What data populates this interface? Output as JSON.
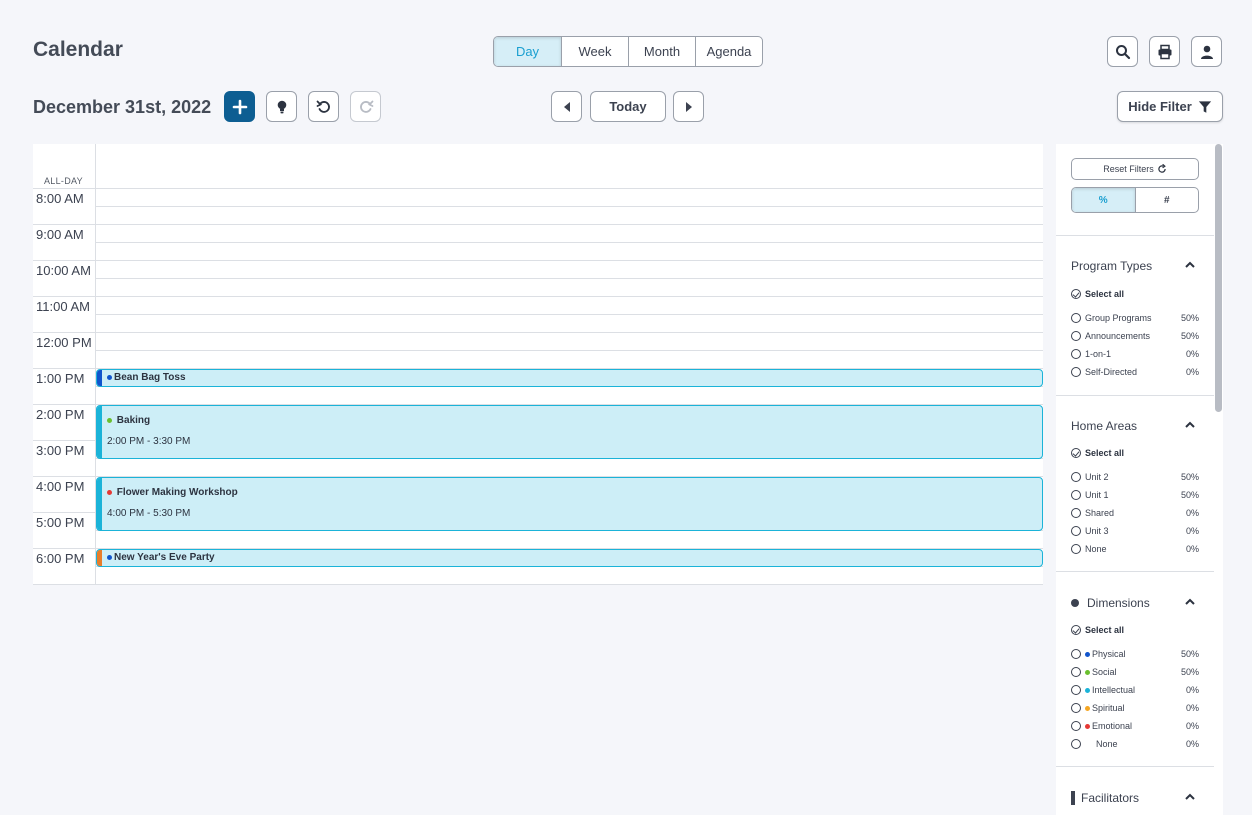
{
  "header": {
    "title": "Calendar",
    "views": [
      "Day",
      "Week",
      "Month",
      "Agenda"
    ],
    "active_view": "Day",
    "date": "December 31st, 2022",
    "today_label": "Today",
    "hide_filter_label": "Hide Filter"
  },
  "icons": {
    "search": "search-icon",
    "print": "print-icon",
    "user": "user-icon",
    "add": "plus-icon",
    "idea": "lightbulb-icon",
    "undo": "undo-icon",
    "redo": "redo-icon",
    "prev": "caret-left-icon",
    "next": "caret-right-icon",
    "filter": "filter-icon"
  },
  "calendar": {
    "allday_label": "ALL-DAY",
    "times": [
      "8:00 AM",
      "9:00 AM",
      "10:00 AM",
      "11:00 AM",
      "12:00 PM",
      "1:00 PM",
      "2:00 PM",
      "3:00 PM",
      "4:00 PM",
      "5:00 PM",
      "6:00 PM"
    ],
    "events": [
      {
        "title": "Bean Bag Toss",
        "time": "",
        "color": "#1155cc",
        "dot": "#1155cc"
      },
      {
        "title": "Baking",
        "time": "2:00 PM - 3:30 PM",
        "color": "#1bb3d8",
        "dot": "#6abf2e"
      },
      {
        "title": "Flower Making Workshop",
        "time": "4:00 PM - 5:30 PM",
        "color": "#1bb3d8",
        "dot": "#e53935"
      },
      {
        "title": "New Year's Eve Party",
        "time": "",
        "color": "#e87d2a",
        "dot": "#1155cc"
      }
    ]
  },
  "filters": {
    "reset_label": "Reset Filters",
    "toggle": [
      "%",
      "#"
    ],
    "select_all": "Select all",
    "program_types": {
      "title": "Program Types",
      "items": [
        {
          "label": "Group Programs",
          "pct": "50%"
        },
        {
          "label": "Announcements",
          "pct": "50%"
        },
        {
          "label": "1-on-1",
          "pct": "0%"
        },
        {
          "label": "Self-Directed",
          "pct": "0%"
        }
      ]
    },
    "home_areas": {
      "title": "Home Areas",
      "items": [
        {
          "label": "Unit 2",
          "pct": "50%"
        },
        {
          "label": "Unit 1",
          "pct": "50%"
        },
        {
          "label": "Shared",
          "pct": "0%"
        },
        {
          "label": "Unit 3",
          "pct": "0%"
        },
        {
          "label": "None",
          "pct": "0%"
        }
      ]
    },
    "dimensions": {
      "title": "Dimensions",
      "items": [
        {
          "label": "Physical",
          "pct": "50%",
          "color": "#1155cc"
        },
        {
          "label": "Social",
          "pct": "50%",
          "color": "#6abf2e"
        },
        {
          "label": "Intellectual",
          "pct": "0%",
          "color": "#1bb3d8"
        },
        {
          "label": "Spiritual",
          "pct": "0%",
          "color": "#f5a623"
        },
        {
          "label": "Emotional",
          "pct": "0%",
          "color": "#e53935"
        },
        {
          "label": "None",
          "pct": "0%",
          "color": ""
        }
      ]
    },
    "facilitators": {
      "title": "Facilitators"
    }
  }
}
